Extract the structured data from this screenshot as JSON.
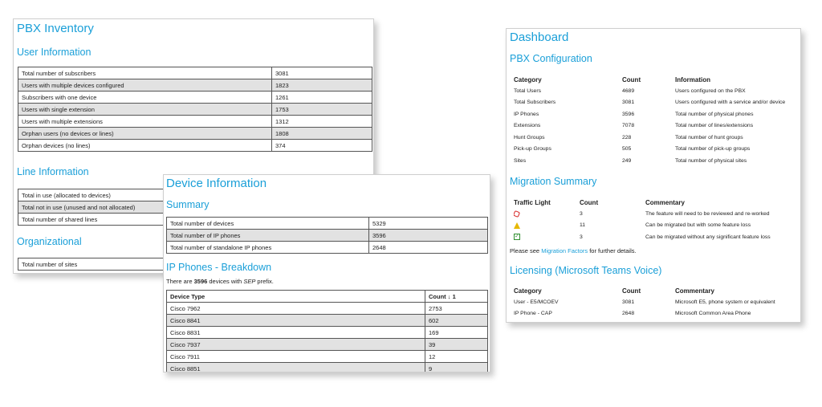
{
  "inventory": {
    "title": "PBX Inventory",
    "user_info": {
      "heading": "User Information",
      "rows": [
        [
          "Total number of subscribers",
          "3081"
        ],
        [
          "Users with multiple devices configured",
          "1823"
        ],
        [
          "Subscribers with one device",
          "1261"
        ],
        [
          "Users with single extension",
          "1753"
        ],
        [
          "Users with multiple extensions",
          "1312"
        ],
        [
          "Orphan users (no devices or lines)",
          "1808"
        ],
        [
          "Orphan devices (no lines)",
          "374"
        ]
      ]
    },
    "line_info": {
      "heading": "Line Information",
      "rows": [
        [
          "Total in use (allocated to devices)"
        ],
        [
          "Total not in use (unused and not allocated)"
        ],
        [
          "Total number of shared lines"
        ]
      ]
    },
    "organizational": {
      "heading": "Organizational",
      "rows": [
        [
          "Total number of sites"
        ]
      ]
    }
  },
  "device": {
    "title": "Device Information",
    "summary": {
      "heading": "Summary",
      "rows": [
        [
          "Total number of devices",
          "5329"
        ],
        [
          "Total number of IP phones",
          "3596"
        ],
        [
          "Total number of standalone IP phones",
          "2648"
        ]
      ]
    },
    "breakdown": {
      "heading": "IP Phones - Breakdown",
      "note_pre": "There are ",
      "note_count": "3596",
      "note_mid": " devices with ",
      "note_prefix": "SEP",
      "note_post": " prefix.",
      "col_type": "Device Type",
      "col_count": "Count ↓ 1",
      "rows": [
        [
          "Cisco 7962",
          "2753"
        ],
        [
          "Cisco 8841",
          "602"
        ],
        [
          "Cisco 8831",
          "169"
        ],
        [
          "Cisco 7937",
          "39"
        ],
        [
          "Cisco 7911",
          "12"
        ],
        [
          "Cisco 8851",
          "9"
        ]
      ]
    }
  },
  "dashboard": {
    "title": "Dashboard",
    "pbx": {
      "heading": "PBX Configuration",
      "headers": [
        "Category",
        "Count",
        "Information"
      ],
      "rows": [
        [
          "Total Users",
          "4689",
          "Users configured on the PBX"
        ],
        [
          "Total Subscribers",
          "3081",
          "Users configured with a service and/or device"
        ],
        [
          "IP Phones",
          "3596",
          "Total number of physical phones"
        ],
        [
          "Extensions",
          "7078",
          "Total number of lines/extensions"
        ],
        [
          "Hunt Groups",
          "228",
          "Total number of hunt groups"
        ],
        [
          "Pick-up Groups",
          "505",
          "Total number of pick-up groups"
        ],
        [
          "Sites",
          "249",
          "Total number of physical sites"
        ]
      ]
    },
    "migration": {
      "heading": "Migration Summary",
      "headers": [
        "Traffic Light",
        "Count",
        "Commentary"
      ],
      "rows": [
        {
          "icon": "stop-octagon-icon",
          "color": "#d62020",
          "count": "3",
          "text": "The feature will need to be reviewed and re-worked"
        },
        {
          "icon": "warning-triangle-icon",
          "color": "#e6b800",
          "count": "11",
          "text": "Can be migrated but with some feature loss"
        },
        {
          "icon": "check-box-icon",
          "color": "#2f8f2f",
          "count": "3",
          "text": "Can be migrated without any significant feature loss"
        }
      ],
      "note_pre": "Please see ",
      "note_link": "Migration Factors",
      "note_post": " for further details."
    },
    "licensing": {
      "heading": "Licensing (Microsoft Teams Voice)",
      "headers": [
        "Category",
        "Count",
        "Commentary"
      ],
      "rows": [
        [
          "User - E5/MCOEV",
          "3081",
          "Microsoft E5, phone system or equivalent"
        ],
        [
          "IP Phone - CAP",
          "2648",
          "Microsoft Common Area Phone"
        ]
      ]
    }
  }
}
